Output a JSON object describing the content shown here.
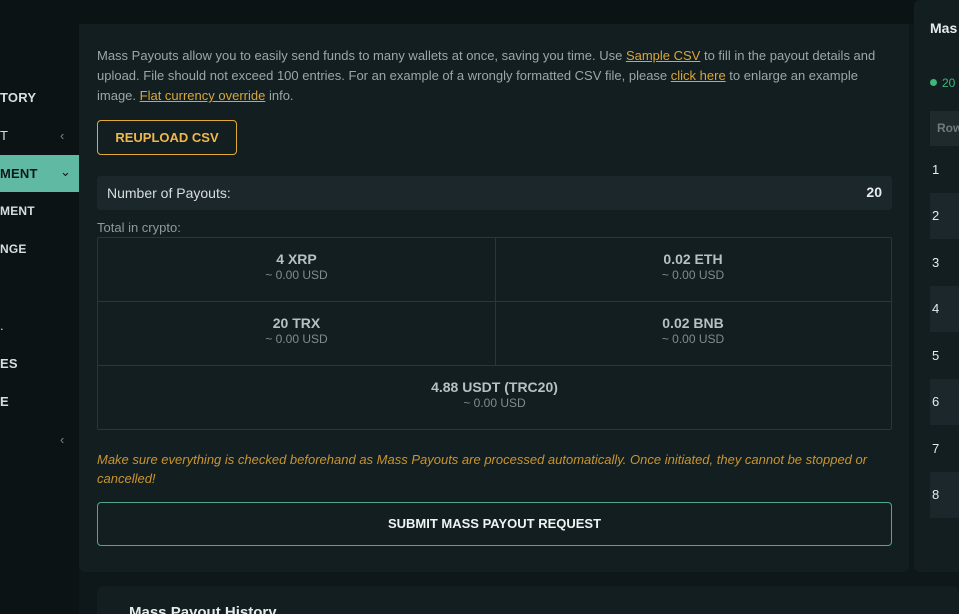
{
  "sidebar": {
    "items": [
      {
        "label": "TORY",
        "chevron": ""
      },
      {
        "label": "T",
        "chevron": "‹"
      },
      {
        "label": "MENT",
        "chevron": "⌄",
        "active": true
      },
      {
        "label": "MENT",
        "chevron": ""
      },
      {
        "label": "NGE",
        "chevron": ""
      },
      {
        "label": "",
        "chevron": ""
      },
      {
        "label": ".",
        "chevron": ""
      },
      {
        "label": "ES",
        "chevron": ""
      },
      {
        "label": "E",
        "chevron": ""
      }
    ],
    "collapse_icon": "‹"
  },
  "main": {
    "description": {
      "part1": "Mass Payouts allow you to easily send funds to many wallets at once, saving you time. Use ",
      "link1": "Sample CSV",
      "part2": " to fill in the payout details and upload. File should not exceed 100 entries. For an example of a wrongly formatted CSV file, please ",
      "link2": "click here",
      "part3": " to enlarge an example image. ",
      "link3": "Flat currency override",
      "part4": " info."
    },
    "reupload_label": "REUPLOAD CSV",
    "payouts_label": "Number of Payouts:",
    "payouts_value": "20",
    "total_label": "Total in crypto:",
    "totals": [
      {
        "amount": "4 XRP",
        "usd": "~ 0.00 USD"
      },
      {
        "amount": "0.02 ETH",
        "usd": "~ 0.00 USD"
      },
      {
        "amount": "20 TRX",
        "usd": "~ 0.00 USD"
      },
      {
        "amount": "0.02 BNB",
        "usd": "~ 0.00 USD"
      },
      {
        "amount": "4.88 USDT (TRC20)",
        "usd": "~ 0.00 USD"
      }
    ],
    "warning": "Make sure everything is checked beforehand as Mass Payouts are processed automatically. Once initiated, they cannot be stopped or cancelled!",
    "submit_label": "SUBMIT MASS PAYOUT REQUEST"
  },
  "history": {
    "title": "Mass Payout History"
  },
  "right_panel": {
    "title": "Mas",
    "status": "20",
    "header": "Row",
    "rows": [
      "1",
      "2",
      "3",
      "4",
      "5",
      "6",
      "7",
      "8"
    ]
  },
  "colors": {
    "accent_teal": "#5fb9a3",
    "accent_gold": "#e0a93a",
    "status_green": "#3cb878"
  }
}
